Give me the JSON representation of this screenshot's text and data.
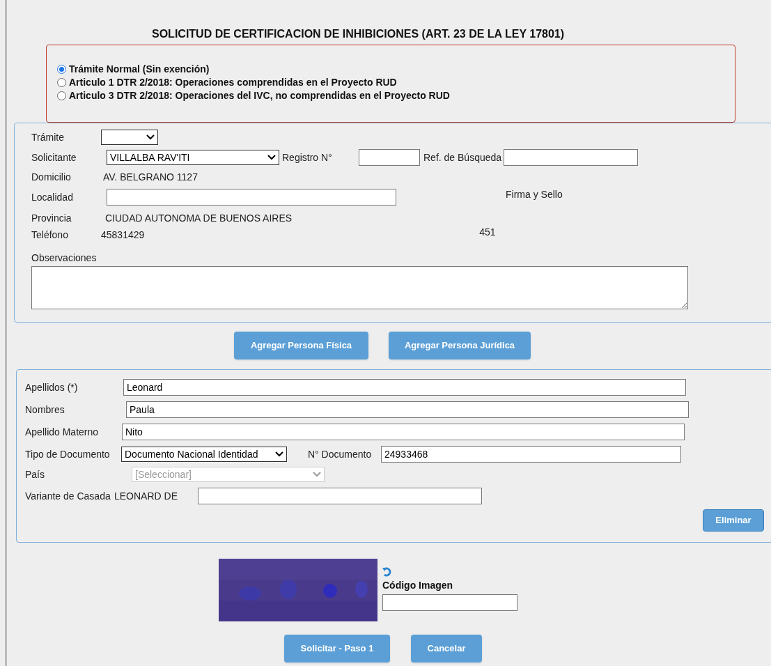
{
  "title": "SOLICITUD DE CERTIFICACION DE INHIBICIONES (ART. 23 DE LA LEY 17801)",
  "exemptions": [
    {
      "label": "Trámite Normal (Sin exención)",
      "selected": true
    },
    {
      "label": "Articulo **1** DTR 2/2018: Operaciones comprendidas en el Proyecto RUD",
      "selected": false
    },
    {
      "label": "Articulo **3** DTR 2/2018: Operaciones del IVC, no comprendidas en el Proyecto RUD",
      "selected": false
    }
  ],
  "request": {
    "tramite": {
      "label": "Trámite"
    },
    "solicitante": {
      "label": "Solicitante",
      "value": "VILLALBA RAV'ITI"
    },
    "registro": {
      "label": "Registro N°"
    },
    "ref_busqueda": {
      "label": "Ref. de Búsqueda"
    },
    "domicilio": {
      "label": "Domicilio",
      "value": "AV. BELGRANO 1127"
    },
    "localidad": {
      "label": "Localidad"
    },
    "firma": {
      "label": "Firma y Sello",
      "value": "451"
    },
    "provincia": {
      "label": "Provincia",
      "value": "CIUDAD AUTONOMA DE BUENOS AIRES"
    },
    "telefono": {
      "label": "Teléfono",
      "value": "45831429"
    },
    "observaciones": {
      "label": "Observaciones"
    }
  },
  "add_buttons": [
    "Agregar Persona Física",
    "Agregar Persona Jurídica"
  ],
  "person": {
    "apellidos": {
      "label": "Apellidos (*)",
      "value": "Leonard"
    },
    "nombres": {
      "label": "Nombres",
      "value": "Paula"
    },
    "materno": {
      "label": "Apellido Materno",
      "value": "Nito"
    },
    "tipo_doc": {
      "label": "Tipo de Documento",
      "value": "Documento Nacional Identidad"
    },
    "nro_doc": {
      "label": "N° Documento",
      "value": "24933468"
    },
    "pais": {
      "label": "País",
      "value": "[Seleccionar]",
      "disabled": true
    },
    "casada": {
      "label": "Variante de Casada",
      "prefix": "LEONARD DE"
    },
    "delete_button": "Eliminar"
  },
  "captcha": {
    "kind": "picture",
    "label": "Código Imagen"
  },
  "footer_buttons": [
    "Solicitar - Paso 1",
    "Cancelar"
  ]
}
